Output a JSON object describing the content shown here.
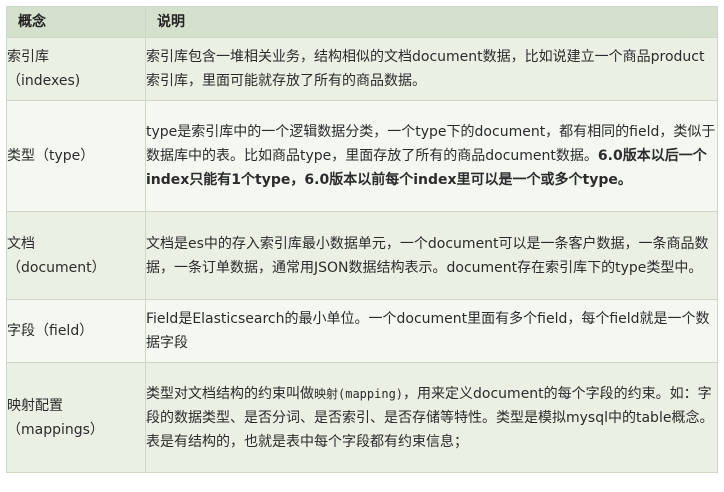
{
  "header": {
    "col1": "概念",
    "col2": "说明"
  },
  "rows": [
    {
      "concept_line1": "索引库",
      "concept_line2": "（indexes)",
      "desc": "索引库包含一堆相关业务，结构相似的文档document数据，比如说建立一个商品product索引库，里面可能就存放了所有的商品数据。"
    },
    {
      "concept_line1": "类型（type）",
      "desc_normal": "type是索引库中的一个逻辑数据分类，一个type下的document，都有相同的field，类似于数据库中的表。比如商品type，里面存放了所有的商品document数据。",
      "desc_bold": "6.0版本以后一个index只能有1个type，6.0版本以前每个index里可以是一个或多个type。"
    },
    {
      "concept_line1": "文档",
      "concept_line2": "（document）",
      "desc": "文档是es中的存入索引库最小数据单元，一个document可以是一条客户数据，一条商品数据，一条订单数据，通常用JSON数据结构表示。document存在索引库下的type类型中。"
    },
    {
      "concept_line1": "字段（field）",
      "desc": "Field是Elasticsearch的最小单位。一个document里面有多个field，每个field就是一个数据字段"
    },
    {
      "concept_line1": "映射配置",
      "concept_line2": "（mappings）",
      "desc_pre": "类型对文档结构的约束叫做",
      "desc_code": "映射(mapping)",
      "desc_post": "，用来定义document的每个字段的约束。如：字段的数据类型、是否分词、是否索引、是否存储等特性。类型是模拟mysql中的table概念。表是有结构的，也就是表中每个字段都有约束信息；"
    }
  ]
}
